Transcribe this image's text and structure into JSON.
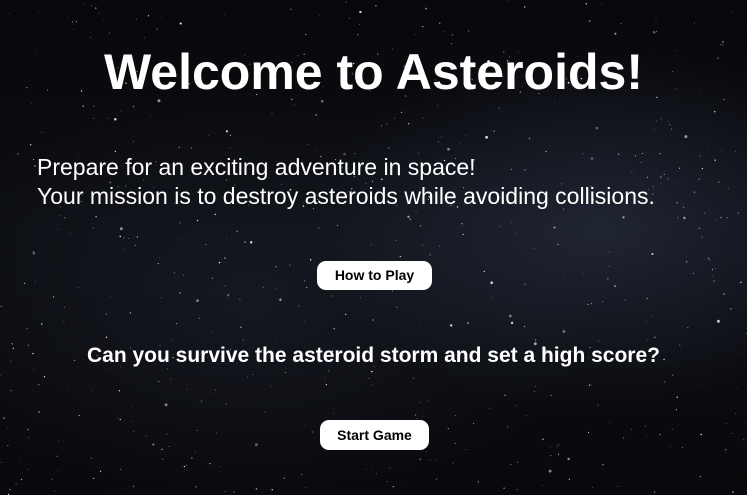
{
  "welcome": {
    "title": "Welcome to Asteroids!",
    "intro_line_1": "Prepare for an exciting adventure in space!",
    "intro_line_2": "Your mission is to destroy asteroids while avoiding collisions.",
    "how_to_play_label": "How to Play",
    "question": "Can you survive the asteroid storm and set a high score?",
    "start_game_label": "Start Game"
  },
  "colors": {
    "background": "#0a0b0f",
    "text": "#ffffff",
    "button_bg": "#ffffff",
    "button_text": "#000000"
  }
}
